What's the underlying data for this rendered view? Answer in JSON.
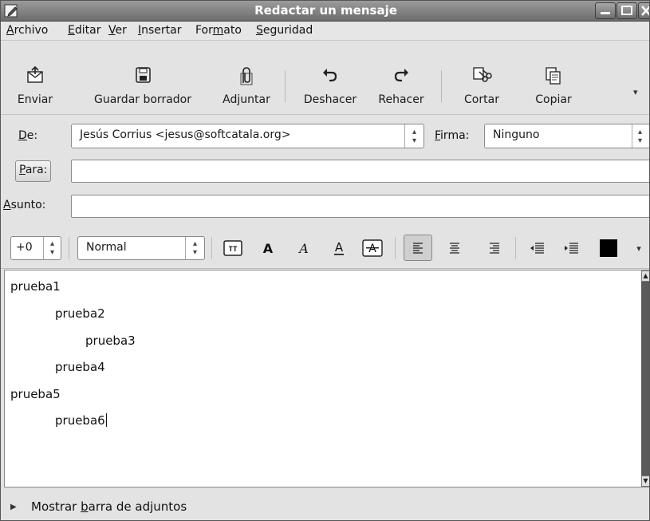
{
  "window": {
    "title": "Redactar un mensaje",
    "icon": "compose-icon",
    "controls": [
      "minimize-icon",
      "maximize-icon",
      "close-icon"
    ]
  },
  "menubar": {
    "items": [
      {
        "label": "Archivo",
        "mnemonic": "A",
        "rest": "rchivo"
      },
      {
        "label": "Editar",
        "mnemonic": "E",
        "rest": "ditar"
      },
      {
        "label": "Ver",
        "mnemonic": "V",
        "rest": "er"
      },
      {
        "label": "Insertar",
        "mnemonic": "I",
        "rest": "nsertar"
      },
      {
        "label": "Formato",
        "pre": "For",
        "mnemonic": "m",
        "rest": "ato"
      },
      {
        "label": "Seguridad",
        "mnemonic": "S",
        "rest": "eguridad"
      }
    ]
  },
  "toolbar": {
    "buttons": [
      {
        "label": "Enviar",
        "icon": "send-envelope-icon"
      },
      {
        "label": "Guardar borrador",
        "icon": "floppy-disk-icon"
      },
      {
        "label": "Adjuntar",
        "icon": "paperclip-icon"
      },
      {
        "label": "Deshacer",
        "icon": "undo-icon"
      },
      {
        "label": "Rehacer",
        "icon": "redo-icon"
      },
      {
        "label": "Cortar",
        "icon": "scissors-icon"
      },
      {
        "label": "Copiar",
        "icon": "copy-icon"
      }
    ],
    "overflow": "▾"
  },
  "address": {
    "from_label_mnemonic": "D",
    "from_label_rest": "e:",
    "from_value": "Jesús Corrius <jesus@softcatala.org>",
    "signature_label_mnemonic": "F",
    "signature_label_rest": "irma:",
    "signature_value": "Ninguno",
    "to_label_mnemonic": "P",
    "to_label_rest": "ara:",
    "to_value": "",
    "subject_label_mnemonic": "A",
    "subject_label_rest": "sunto:",
    "subject_value": ""
  },
  "format": {
    "font_size": "+0",
    "paragraph_style": "Normal",
    "text_color": "#000000",
    "buttons": [
      "font-teletype-icon",
      "bold-icon",
      "italic-icon",
      "underline-icon",
      "strikethrough-icon",
      "align-left-icon",
      "align-center-icon",
      "align-right-icon",
      "outdent-icon",
      "indent-icon",
      "text-color-icon"
    ]
  },
  "editor": {
    "lines": [
      {
        "text": "prueba1",
        "indent": 0
      },
      {
        "text": "prueba2",
        "indent": 1
      },
      {
        "text": "prueba3",
        "indent": 2
      },
      {
        "text": "prueba4",
        "indent": 1
      },
      {
        "text": "prueba5",
        "indent": 0
      },
      {
        "text": "prueba6",
        "indent": 1
      }
    ]
  },
  "attachments": {
    "pre": "Mostrar ",
    "mnemonic": "b",
    "rest": "arra de adjuntos"
  }
}
